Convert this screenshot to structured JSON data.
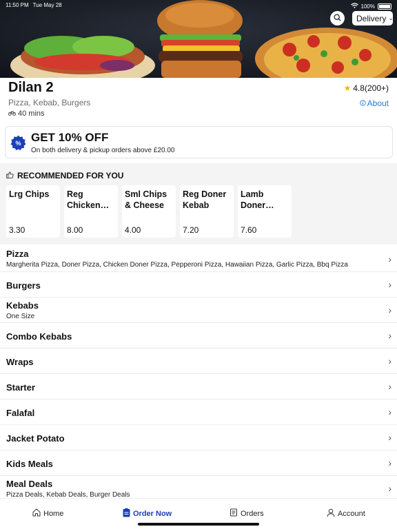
{
  "status_bar": {
    "time": "11:50 PM",
    "date": "Tue May 28",
    "battery": "100%"
  },
  "hero": {
    "delivery_mode": "Delivery"
  },
  "restaurant": {
    "name": "Dilan 2",
    "cuisines": "Pizza, Kebab, Burgers",
    "delivery_time": "40 mins",
    "rating": "4.8(200+)",
    "about_label": "About"
  },
  "offer": {
    "title": "GET 10% OFF",
    "subtitle": "On both delivery & pickup orders above £20.00"
  },
  "recommended": {
    "title": "RECOMMENDED FOR YOU",
    "items": [
      {
        "name": "Lrg Chips",
        "price": "3.30"
      },
      {
        "name": "Reg Chicken Shish",
        "price": "8.00"
      },
      {
        "name": "Sml Chips & Cheese",
        "price": "4.00"
      },
      {
        "name": "Reg Doner Kebab",
        "price": "7.20"
      },
      {
        "name": "Lamb Doner Wrap",
        "price": "7.60"
      }
    ]
  },
  "menu": {
    "categories": [
      {
        "name": "Pizza",
        "desc": "Margherita Pizza, Doner Pizza, Chicken Doner Pizza, Pepperoni Pizza, Hawaiian Pizza, Garlic Pizza, Bbq Pizza"
      },
      {
        "name": "Burgers",
        "desc": ""
      },
      {
        "name": "Kebabs",
        "desc": "One Size"
      },
      {
        "name": "Combo Kebabs",
        "desc": ""
      },
      {
        "name": "Wraps",
        "desc": ""
      },
      {
        "name": "Starter",
        "desc": ""
      },
      {
        "name": "Falafal",
        "desc": ""
      },
      {
        "name": "Jacket Potato",
        "desc": ""
      },
      {
        "name": "Kids Meals",
        "desc": ""
      },
      {
        "name": "Meal Deals",
        "desc": "Pizza Deals, Kebab Deals, Burger Deals"
      }
    ]
  },
  "nav": {
    "home": "Home",
    "order_now": "Order Now",
    "orders": "Orders",
    "account": "Account"
  },
  "colors": {
    "accent": "#1c3fb8",
    "link": "#2a7ac8",
    "star": "#f4b400"
  }
}
